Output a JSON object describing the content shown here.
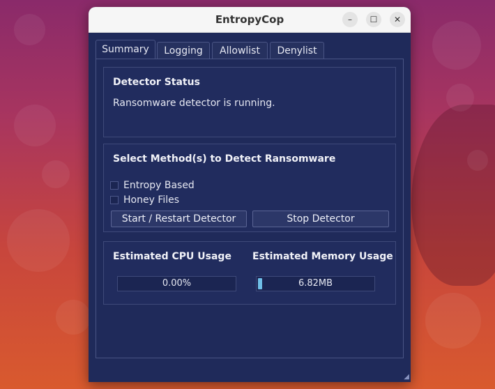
{
  "window": {
    "title": "EntropyCop"
  },
  "tabs": [
    {
      "label": "Summary",
      "active": true
    },
    {
      "label": "Logging",
      "active": false
    },
    {
      "label": "Allowlist",
      "active": false
    },
    {
      "label": "Denylist",
      "active": false
    }
  ],
  "status": {
    "heading": "Detector Status",
    "message": "Ransomware detector is running."
  },
  "methods": {
    "heading": "Select Method(s) to Detect Ransomware",
    "options": [
      {
        "label": "Entropy Based",
        "checked": false
      },
      {
        "label": "Honey Files",
        "checked": false
      }
    ],
    "start_label": "Start / Restart Detector",
    "stop_label": "Stop Detector"
  },
  "usage": {
    "cpu_heading": "Estimated CPU Usage",
    "cpu_value": "0.00%",
    "cpu_fraction": 0.0,
    "mem_heading": "Estimated Memory Usage",
    "mem_value": "6.82MB",
    "mem_fraction": 0.03
  },
  "colors": {
    "window_bg": "#1f2a5a",
    "progress_fill": "#6fbfe8"
  }
}
